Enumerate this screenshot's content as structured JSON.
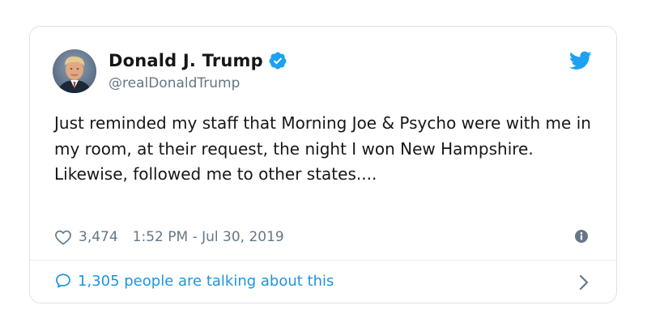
{
  "tweet": {
    "author": {
      "display_name": "Donald J. Trump",
      "handle": "@realDonaldTrump",
      "verified": true,
      "avatar_icon": "profile-photo"
    },
    "text": "Just reminded my staff that Morning Joe & Psycho were with me in my room, at their request, the night I won New Hampshire. Likewise, followed me to other states....",
    "likes": "3,474",
    "timestamp": "1:52 PM - Jul 30, 2019",
    "icons": {
      "brand": "twitter-bird-icon",
      "like": "heart-icon",
      "info": "info-icon",
      "reply": "reply-bubble-icon",
      "chevron": "chevron-right-icon"
    },
    "colors": {
      "brand_blue": "#1da1f2",
      "link_blue": "#1b95e0",
      "text_primary": "#14171a",
      "text_secondary": "#657786",
      "border": "#dde3e8"
    }
  },
  "footer": {
    "talking_label": "1,305 people are talking about this"
  }
}
